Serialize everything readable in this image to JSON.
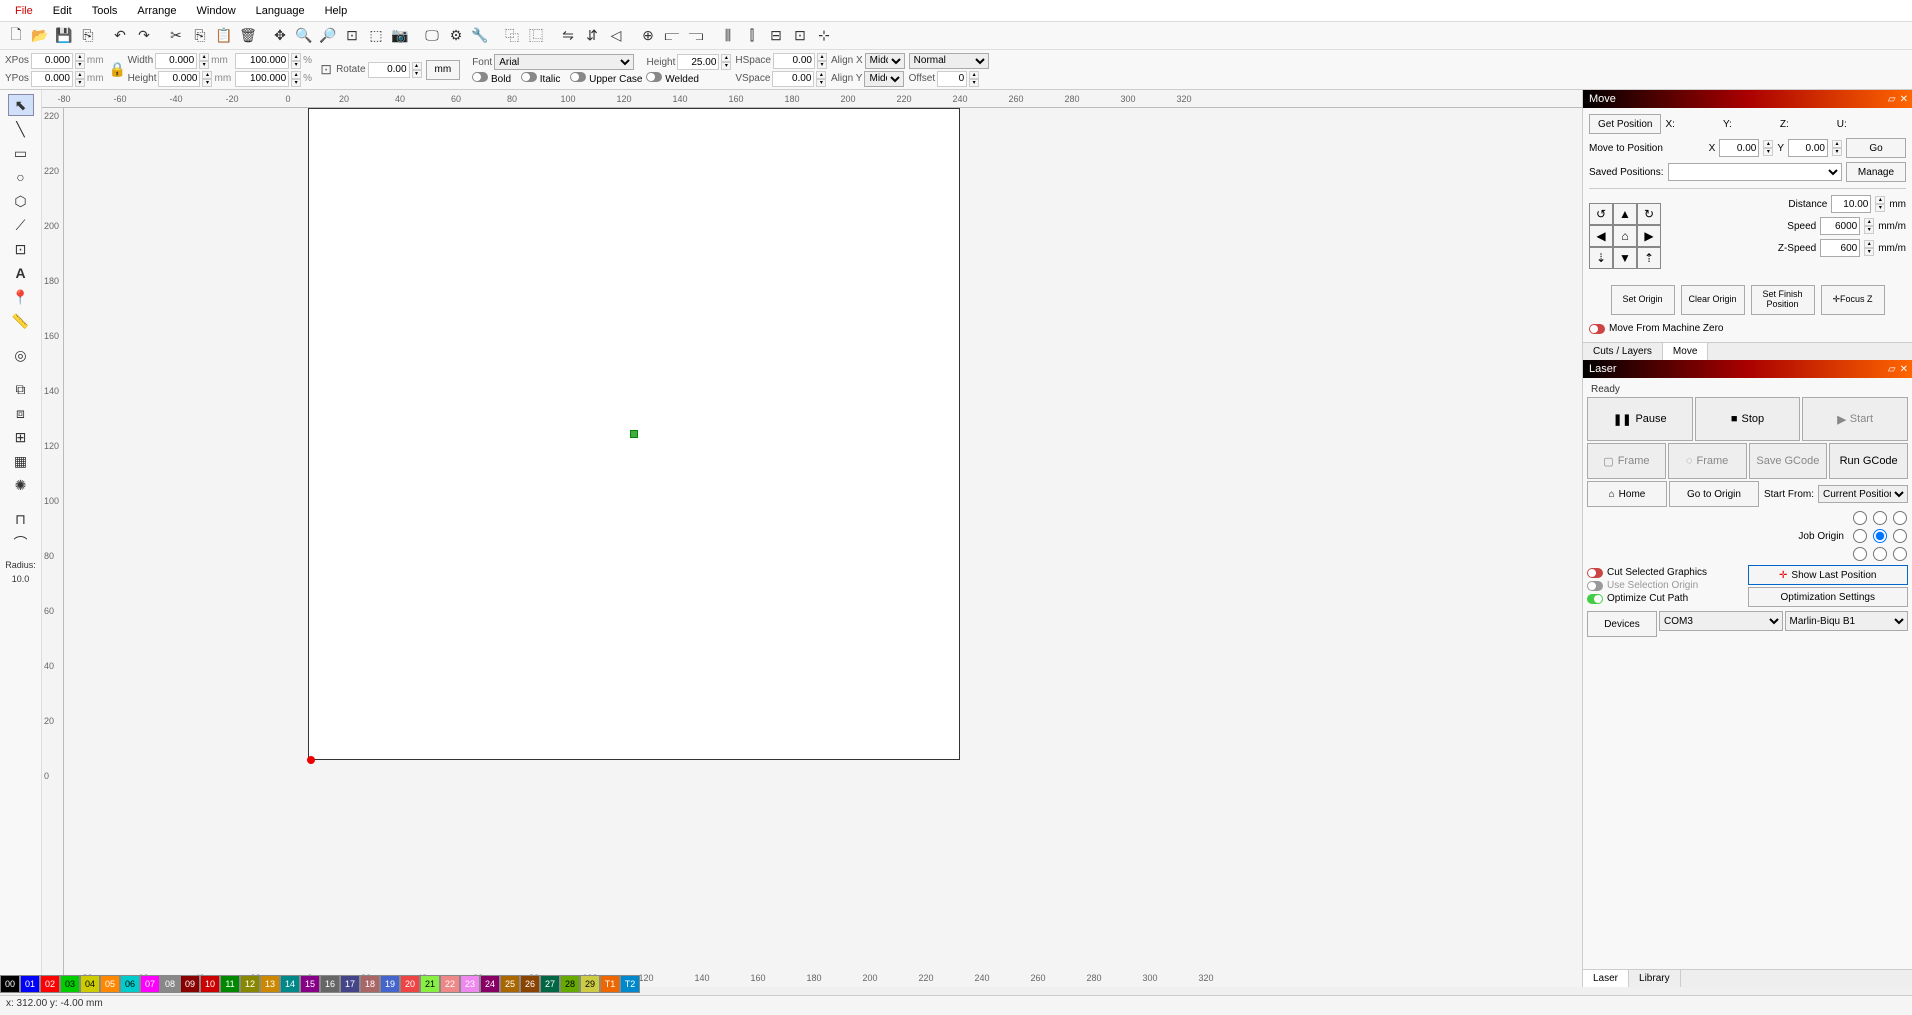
{
  "menu": [
    "File",
    "Edit",
    "Tools",
    "Arrange",
    "Window",
    "Language",
    "Help"
  ],
  "props": {
    "xpos_label": "XPos",
    "xpos": "0.000",
    "ypos_label": "YPos",
    "ypos": "0.000",
    "width_label": "Width",
    "width": "0.000",
    "height_label": "Height",
    "height": "0.000",
    "pct1": "100.000",
    "pct2": "100.000",
    "rotate_label": "Rotate",
    "rotate": "0.00",
    "unit": "mm",
    "pct": "%",
    "mm_btn": "mm",
    "font_label": "Font",
    "font": "Arial",
    "fheight_label": "Height",
    "fheight": "25.00",
    "hspace_label": "HSpace",
    "hspace": "0.00",
    "vspace_label": "VSpace",
    "vspace": "0.00",
    "alignx_label": "Align X",
    "aligny_label": "Align Y",
    "align_val": "Middle",
    "style": "Normal",
    "bold": "Bold",
    "italic": "Italic",
    "upper": "Upper Case",
    "welded": "Welded",
    "offset_label": "Offset",
    "offset": "0"
  },
  "left_tools": {
    "radius_label": "Radius:",
    "radius": "10.0"
  },
  "ruler_ticks": [
    "-80",
    "-60",
    "-40",
    "-20",
    "0",
    "20",
    "40",
    "60",
    "80",
    "100",
    "120",
    "140",
    "160",
    "180",
    "200",
    "220",
    "240",
    "260",
    "280",
    "300",
    "320"
  ],
  "ruler_v": [
    "220",
    "220",
    "200",
    "180",
    "160",
    "140",
    "120",
    "100",
    "80",
    "60",
    "40",
    "20",
    "0"
  ],
  "move": {
    "title": "Move",
    "get_pos": "Get Position",
    "x": "X:",
    "y": "Y:",
    "z": "Z:",
    "u": "U:",
    "move_to": "Move to Position",
    "xl": "X",
    "yl": "Y",
    "xv": "0.00",
    "yv": "0.00",
    "go": "Go",
    "saved": "Saved Positions:",
    "manage": "Manage",
    "distance_label": "Distance",
    "distance": "10.00",
    "speed_label": "Speed",
    "speed": "6000",
    "zspeed_label": "Z-Speed",
    "zspeed": "600",
    "mm": "mm",
    "mmm": "mm/m",
    "set_origin": "Set\nOrigin",
    "clear_origin": "Clear\nOrigin",
    "set_finish": "Set Finish\nPosition",
    "focus_z": "Focus Z",
    "move_zero": "Move From Machine Zero",
    "tab_cuts": "Cuts / Layers",
    "tab_move": "Move"
  },
  "laser": {
    "title": "Laser",
    "ready": "Ready",
    "pause": "Pause",
    "stop": "Stop",
    "start": "Start",
    "frame1": "Frame",
    "frame2": "Frame",
    "save_gcode": "Save GCode",
    "run_gcode": "Run GCode",
    "home": "Home",
    "go_origin": "Go to Origin",
    "start_from": "Start From:",
    "start_from_val": "Current Position",
    "job_origin": "Job Origin",
    "cut_sel": "Cut Selected Graphics",
    "use_sel": "Use Selection Origin",
    "opt_cut": "Optimize Cut Path",
    "show_last": "Show Last Position",
    "opt_settings": "Optimization Settings",
    "devices": "Devices",
    "com": "COM3",
    "machine": "Marlin-Biqu B1",
    "tab_laser": "Laser",
    "tab_lib": "Library"
  },
  "colors": [
    {
      "n": "00",
      "c": "#000"
    },
    {
      "n": "01",
      "c": "#00f"
    },
    {
      "n": "02",
      "c": "#f00"
    },
    {
      "n": "03",
      "c": "#0c0"
    },
    {
      "n": "04",
      "c": "#cc0"
    },
    {
      "n": "05",
      "c": "#f80"
    },
    {
      "n": "06",
      "c": "#0cc"
    },
    {
      "n": "07",
      "c": "#f0f"
    },
    {
      "n": "08",
      "c": "#888"
    },
    {
      "n": "09",
      "c": "#800"
    },
    {
      "n": "10",
      "c": "#c00"
    },
    {
      "n": "11",
      "c": "#080"
    },
    {
      "n": "12",
      "c": "#880"
    },
    {
      "n": "13",
      "c": "#c80"
    },
    {
      "n": "14",
      "c": "#088"
    },
    {
      "n": "15",
      "c": "#808"
    },
    {
      "n": "16",
      "c": "#666"
    },
    {
      "n": "17",
      "c": "#448"
    },
    {
      "n": "18",
      "c": "#a66"
    },
    {
      "n": "19",
      "c": "#46c"
    },
    {
      "n": "20",
      "c": "#e44"
    },
    {
      "n": "21",
      "c": "#8e4"
    },
    {
      "n": "22",
      "c": "#e88"
    },
    {
      "n": "23",
      "c": "#e8e"
    },
    {
      "n": "24",
      "c": "#806"
    },
    {
      "n": "25",
      "c": "#a60"
    },
    {
      "n": "26",
      "c": "#840"
    },
    {
      "n": "27",
      "c": "#064"
    },
    {
      "n": "28",
      "c": "#6a0"
    },
    {
      "n": "29",
      "c": "#cc4"
    },
    {
      "n": "T1",
      "c": "#e60"
    },
    {
      "n": "T2",
      "c": "#08c"
    }
  ],
  "status": "x: 312.00   y: -4.00 mm"
}
